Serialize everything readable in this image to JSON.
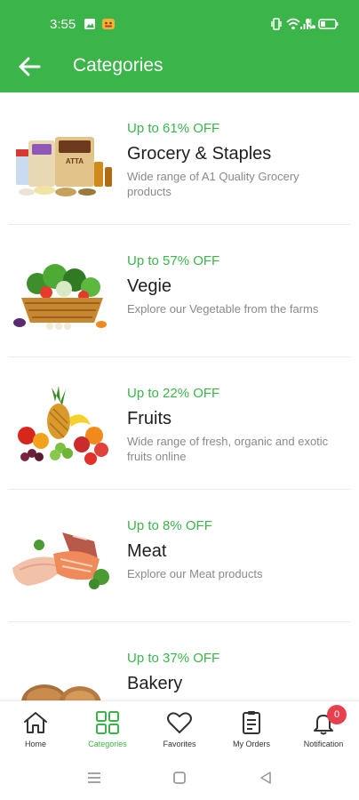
{
  "status_bar": {
    "time": "3:55"
  },
  "app_bar": {
    "title": "Categories"
  },
  "theme": {
    "accent": "#3bb54a",
    "badge": "#e8404f"
  },
  "categories": [
    {
      "offer": "Up to 61% OFF",
      "name": "Grocery & Staples",
      "description": "Wide range of A1 Quality Grocery products",
      "image": "grocery-image",
      "package_label": "ATTA"
    },
    {
      "offer": "Up to 57% OFF",
      "name": "Vegie",
      "description": "Explore our Vegetable from the farms",
      "image": "vegetable-basket-image"
    },
    {
      "offer": "Up to 22% OFF",
      "name": "Fruits",
      "description": "Wide range of fresh, organic and exotic fruits online",
      "image": "fruits-image"
    },
    {
      "offer": "Up to 8% OFF",
      "name": "Meat",
      "description": "Explore our Meat products",
      "image": "meat-image"
    },
    {
      "offer": "Up to 37% OFF",
      "name": "Bakery",
      "description": "",
      "image": "bakery-image"
    }
  ],
  "bottom_nav": {
    "items": [
      {
        "label": "Home",
        "icon": "home-icon"
      },
      {
        "label": "Categories",
        "icon": "grid-icon",
        "active": true
      },
      {
        "label": "Favorites",
        "icon": "heart-icon"
      },
      {
        "label": "My Orders",
        "icon": "clipboard-icon"
      },
      {
        "label": "Notification",
        "icon": "bell-icon",
        "badge": "0"
      }
    ]
  }
}
